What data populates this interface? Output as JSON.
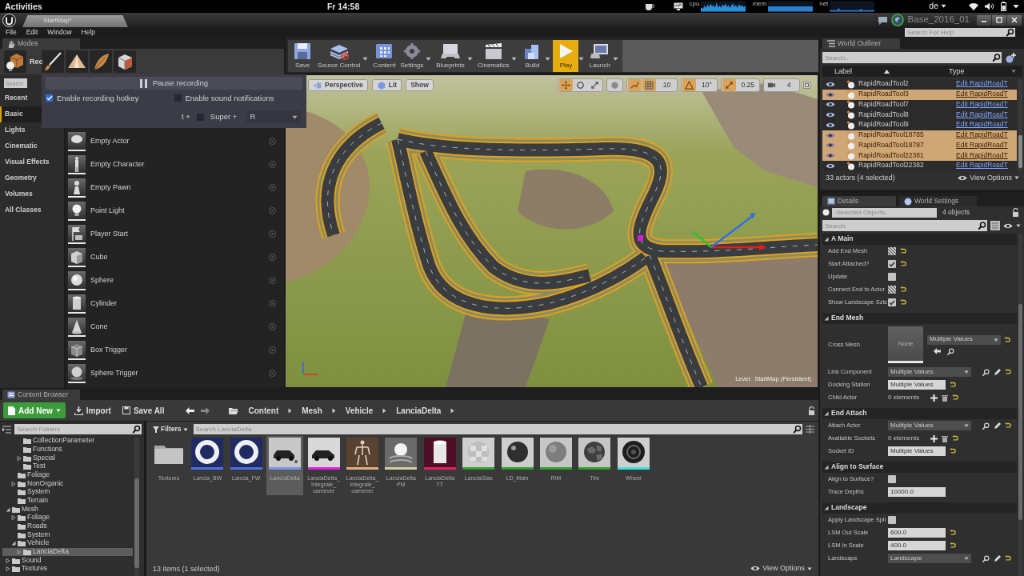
{
  "system_bar": {
    "activities": "Activities",
    "clock": "Fr 14:58",
    "monitors": [
      {
        "label": "cpu"
      },
      {
        "label": "mem"
      },
      {
        "label": "net"
      }
    ],
    "keyboard_layout": "de"
  },
  "window": {
    "map_tab": "StartMap*",
    "project": "Base_2016_01",
    "menu": [
      "File",
      "Edit",
      "Window",
      "Help"
    ],
    "help_search": {
      "placeholder": "Search For Help"
    }
  },
  "modes": {
    "title": "Modes",
    "tool_label": "Rec",
    "search": {
      "placeholder": "Search"
    },
    "categories": [
      {
        "label": "Recent",
        "selected": false
      },
      {
        "label": "Basic",
        "selected": true
      },
      {
        "label": "Lights",
        "selected": false
      },
      {
        "label": "Cinematic",
        "selected": false
      },
      {
        "label": "Visual Effects",
        "selected": false
      },
      {
        "label": "Geometry",
        "selected": false
      },
      {
        "label": "Volumes",
        "selected": false
      },
      {
        "label": "All Classes",
        "selected": false
      }
    ],
    "items": [
      "Empty Actor",
      "Empty Character",
      "Empty Pawn",
      "Point Light",
      "Player Start",
      "Cube",
      "Sphere",
      "Cylinder",
      "Cone",
      "Box Trigger",
      "Sphere Trigger"
    ]
  },
  "recording_popup": {
    "pause": "Pause recording",
    "options": [
      {
        "label": "Enable recording hotkey",
        "checked": true
      },
      {
        "label": "Enable sound notifications",
        "checked": false
      }
    ],
    "shortcut": {
      "prefix": "t +",
      "modifier": "Super +",
      "modifier_checked": false,
      "key": "R"
    }
  },
  "toolbar": [
    {
      "label": "Save",
      "dropdown": false,
      "highlighted": false
    },
    {
      "label": "Source Control",
      "dropdown": true,
      "highlighted": false
    },
    {
      "label": "Content",
      "dropdown": false,
      "highlighted": false
    },
    {
      "label": "Settings",
      "dropdown": true,
      "highlighted": false
    },
    {
      "label": "Blueprints",
      "dropdown": true,
      "highlighted": false
    },
    {
      "label": "Cinematics",
      "dropdown": true,
      "highlighted": false
    },
    {
      "label": "Build",
      "dropdown": true,
      "highlighted": false
    },
    {
      "label": "Play",
      "dropdown": true,
      "highlighted": true
    },
    {
      "label": "Launch",
      "dropdown": true,
      "highlighted": false
    }
  ],
  "viewport": {
    "buttons": [
      "Perspective",
      "Lit",
      "Show"
    ],
    "grid_snap": "10",
    "rotation_snap": "10°",
    "scale_snap": "0.25",
    "camera_speed": "4",
    "level_label": "Level:",
    "level_name": "StartMap (Persistent)"
  },
  "world_outliner": {
    "title": "World Outliner",
    "search": {
      "placeholder": "Search..."
    },
    "columns": [
      "Label",
      "Type"
    ],
    "rows": [
      {
        "label": "RapidRoadTool2",
        "type": "Edit RapidRoadT",
        "selected": false
      },
      {
        "label": "RapidRoadTool3",
        "type": "Edit RapidRoadT",
        "selected": true
      },
      {
        "label": "RapidRoadTool7",
        "type": "Edit RapidRoadT",
        "selected": false
      },
      {
        "label": "RapidRoadTool8",
        "type": "Edit RapidRoadT",
        "selected": false
      },
      {
        "label": "RapidRoadTool9",
        "type": "Edit RapidRoadT",
        "selected": false
      },
      {
        "label": "RapidRoadTool18785",
        "type": "Edit RapidRoadT",
        "selected": true
      },
      {
        "label": "RapidRoadTool18787",
        "type": "Edit RapidRoadT",
        "selected": true
      },
      {
        "label": "RapidRoadTool22381",
        "type": "Edit RapidRoadT",
        "selected": true
      },
      {
        "label": "RapidRoadTool22382",
        "type": "Edit RapidRoadT",
        "selected": false
      }
    ],
    "summary": "33 actors (4 selected)",
    "view_options": "View Options"
  },
  "details": {
    "tabs": [
      {
        "label": "Details",
        "selected": true
      },
      {
        "label": "World Settings",
        "selected": false
      }
    ],
    "object": "-Selected Objects-",
    "object_count": "4 objects",
    "search": {
      "placeholder": "Search"
    },
    "sections": [
      {
        "title": "A Main",
        "expanded": true,
        "rows": [
          {
            "kind": "checkbox",
            "label": "Add End Mesh",
            "checked": false,
            "mixed": true,
            "reset": true
          },
          {
            "kind": "checkbox",
            "label": "Start Attached?",
            "checked": true,
            "mixed": false,
            "reset": true
          },
          {
            "kind": "checkbox",
            "label": "Update",
            "checked": false,
            "mixed": false,
            "reset": false
          },
          {
            "kind": "checkbox",
            "label": "Connect End to Actor",
            "checked": false,
            "mixed": true,
            "reset": true
          },
          {
            "kind": "checkbox",
            "label": "Show Landscape Szis",
            "checked": true,
            "mixed": false,
            "reset": true
          }
        ]
      },
      {
        "title": "End Mesh",
        "expanded": true,
        "rows": [
          {
            "kind": "asset",
            "label": "Cross Mesh",
            "thumbnail": "None",
            "value": "Multiple Values",
            "reset": true
          },
          {
            "kind": "picker",
            "label": "Link Component",
            "value": "Multiple Values",
            "reset": true
          },
          {
            "kind": "field",
            "label": "Docking Station",
            "value": "Multiple Values",
            "reset": true
          },
          {
            "kind": "array",
            "label": "Child Actor",
            "value": "0 elements",
            "reset": true
          }
        ]
      },
      {
        "title": "End Attach",
        "expanded": true,
        "rows": [
          {
            "kind": "picker",
            "label": "Attach Actor",
            "value": "Multiple Values",
            "reset": true
          },
          {
            "kind": "array",
            "label": "Available Sockets",
            "value": "0 elements",
            "reset": true
          },
          {
            "kind": "field",
            "label": "Socket ID",
            "value": "Multiple Values",
            "reset": true
          }
        ]
      },
      {
        "title": "Align to Surface",
        "expanded": true,
        "rows": [
          {
            "kind": "checkbox",
            "label": "Align to Surface?",
            "checked": false,
            "mixed": false,
            "reset": false
          },
          {
            "kind": "field",
            "label": "Trace Depths",
            "value": "10000.0",
            "reset": false
          }
        ]
      },
      {
        "title": "Landscape",
        "expanded": true,
        "rows": [
          {
            "kind": "checkbox",
            "label": "Apply Landscape Spli",
            "checked": false,
            "mixed": false,
            "reset": false
          },
          {
            "kind": "field",
            "label": "LSM Out Scale",
            "value": "600.0",
            "reset": true
          },
          {
            "kind": "field",
            "label": "LSM In Scale",
            "value": "400.0",
            "reset": true
          },
          {
            "kind": "picker",
            "label": "Landscape",
            "value": "Landscape",
            "reset": true
          }
        ]
      }
    ]
  },
  "content_browser": {
    "title": "Content Browser",
    "buttons": [
      "Add New",
      "Import",
      "Save All"
    ],
    "path": [
      "Content",
      "Mesh",
      "Vehicle",
      "LanciaDelta"
    ],
    "folder_search": {
      "placeholder": "Search Folders"
    },
    "folders": [
      {
        "children": [
          {
            "children": [
              {
                "label": "CollectionParameter",
                "selected": false
              },
              {
                "label": "Functions",
                "selected": false
              },
              {
                "label": "Special",
                "selected": false,
                "expanded": false
              },
              {
                "label": "Test",
                "selected": false
              }
            ]
          },
          {
            "label": "Foliage",
            "selected": false
          },
          {
            "label": "NonOrganic",
            "selected": false,
            "expanded": false
          },
          {
            "label": "System",
            "selected": false
          },
          {
            "label": "Terrain",
            "selected": false
          }
        ]
      },
      {
        "label": "Mesh",
        "selected": false,
        "expanded": true,
        "children": [
          {
            "label": "Foliage",
            "selected": false,
            "expanded": false
          },
          {
            "label": "Roads",
            "selected": false
          },
          {
            "label": "System",
            "selected": false
          },
          {
            "label": "Vehicle",
            "selected": false,
            "expanded": true,
            "children": [
              {
                "label": "LanciaDelta",
                "selected": true,
                "expanded": false
              }
            ]
          }
        ]
      },
      {
        "label": "Sound",
        "selected": false,
        "expanded": false
      },
      {
        "label": "Textures",
        "selected": false,
        "expanded": false
      }
    ],
    "filters": "Filters",
    "asset_search": {
      "placeholder": "Search LanciaDelta"
    },
    "assets": [
      {
        "label": "Textures",
        "selected": false
      },
      {
        "label": "Lancia_BW",
        "color": "#4f6fe0",
        "selected": false
      },
      {
        "label": "Lancia_FW",
        "color": "#4f6fe0",
        "selected": false
      },
      {
        "label": "LanciaDelta",
        "color": "#7d95e8",
        "selected": true
      },
      {
        "label": "LanciaDelta_Integrale_oamever",
        "color": "#e020e0",
        "selected": false
      },
      {
        "label": "LanciaDelta_Integrale_oamever",
        "color": "#e0b080",
        "selected": false
      },
      {
        "label": "LanciaDelta PM",
        "color": "#d8d0a0",
        "selected": false
      },
      {
        "label": "LanciaDelta TT",
        "color": "#e02060",
        "selected": false
      },
      {
        "label": "LanciaGlas",
        "color": "#30a030",
        "selected": false
      },
      {
        "label": "LD_Main",
        "color": "#30a030",
        "selected": false
      },
      {
        "label": "RIM",
        "color": "#30a030",
        "selected": false
      },
      {
        "label": "Tire",
        "color": "#30a030",
        "selected": false
      },
      {
        "label": "Wheel",
        "color": "#40e0e0",
        "selected": false
      }
    ],
    "summary": "13 items (1 selected)",
    "view_options": "View Options"
  }
}
